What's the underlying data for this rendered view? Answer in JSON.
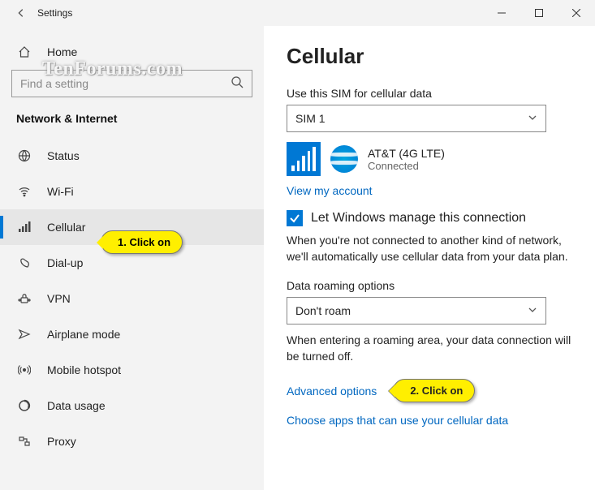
{
  "window": {
    "title": "Settings"
  },
  "sidebar": {
    "home": "Home",
    "search_placeholder": "Find a setting",
    "section": "Network & Internet",
    "items": [
      {
        "label": "Status"
      },
      {
        "label": "Wi-Fi"
      },
      {
        "label": "Cellular"
      },
      {
        "label": "Dial-up"
      },
      {
        "label": "VPN"
      },
      {
        "label": "Airplane mode"
      },
      {
        "label": "Mobile hotspot"
      },
      {
        "label": "Data usage"
      },
      {
        "label": "Proxy"
      }
    ]
  },
  "main": {
    "heading": "Cellular",
    "sim_label": "Use this SIM for cellular data",
    "sim_value": "SIM 1",
    "carrier_name": "AT&T (4G LTE)",
    "carrier_status": "Connected",
    "view_account": "View my account",
    "checkbox_label": "Let Windows manage this connection",
    "checkbox_desc": "When you're not connected to another kind of network, we'll automatically use cellular data from your data plan.",
    "roaming_label": "Data roaming options",
    "roaming_value": "Don't roam",
    "roaming_desc": "When entering a roaming area, your data connection will be turned off.",
    "advanced": "Advanced options",
    "choose_apps": "Choose apps that can use your cellular data"
  },
  "callouts": {
    "c1": "1. Click on",
    "c2": "2. Click on"
  },
  "watermark": "TenForums.com"
}
